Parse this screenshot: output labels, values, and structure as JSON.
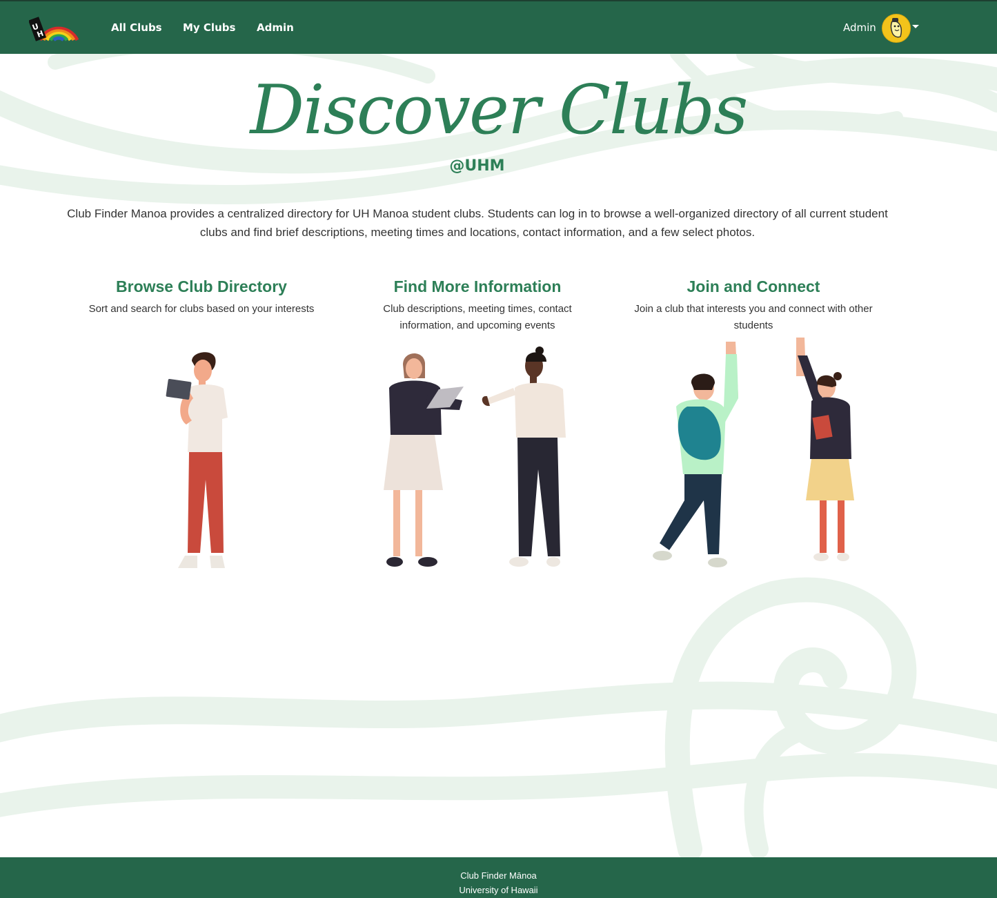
{
  "nav": {
    "links": [
      "All Clubs",
      "My Clubs",
      "Admin"
    ],
    "user": "Admin"
  },
  "hero": {
    "title": "Discover Clubs",
    "subtitle": "@UHM",
    "intro": "Club Finder Manoa provides a centralized directory for UH Manoa student clubs. Students can log in to browse a well-organized directory of all current student clubs and find brief descriptions, meeting times and locations, contact information, and a few select photos."
  },
  "features": [
    {
      "title": "Browse Club Directory",
      "text": "Sort and search for clubs based on your interests"
    },
    {
      "title": "Find More Information",
      "text": "Club descriptions, meeting times, contact information, and upcoming events"
    },
    {
      "title": "Join and Connect",
      "text": "Join a club that interests you and connect with other students"
    }
  ],
  "footer": {
    "line1": "Club Finder Mānoa",
    "line2": "University of Hawaii"
  },
  "colors": {
    "brand_green": "#25664a",
    "heading_green": "#2d7f57",
    "wave_tint": "#eaf4ec"
  }
}
